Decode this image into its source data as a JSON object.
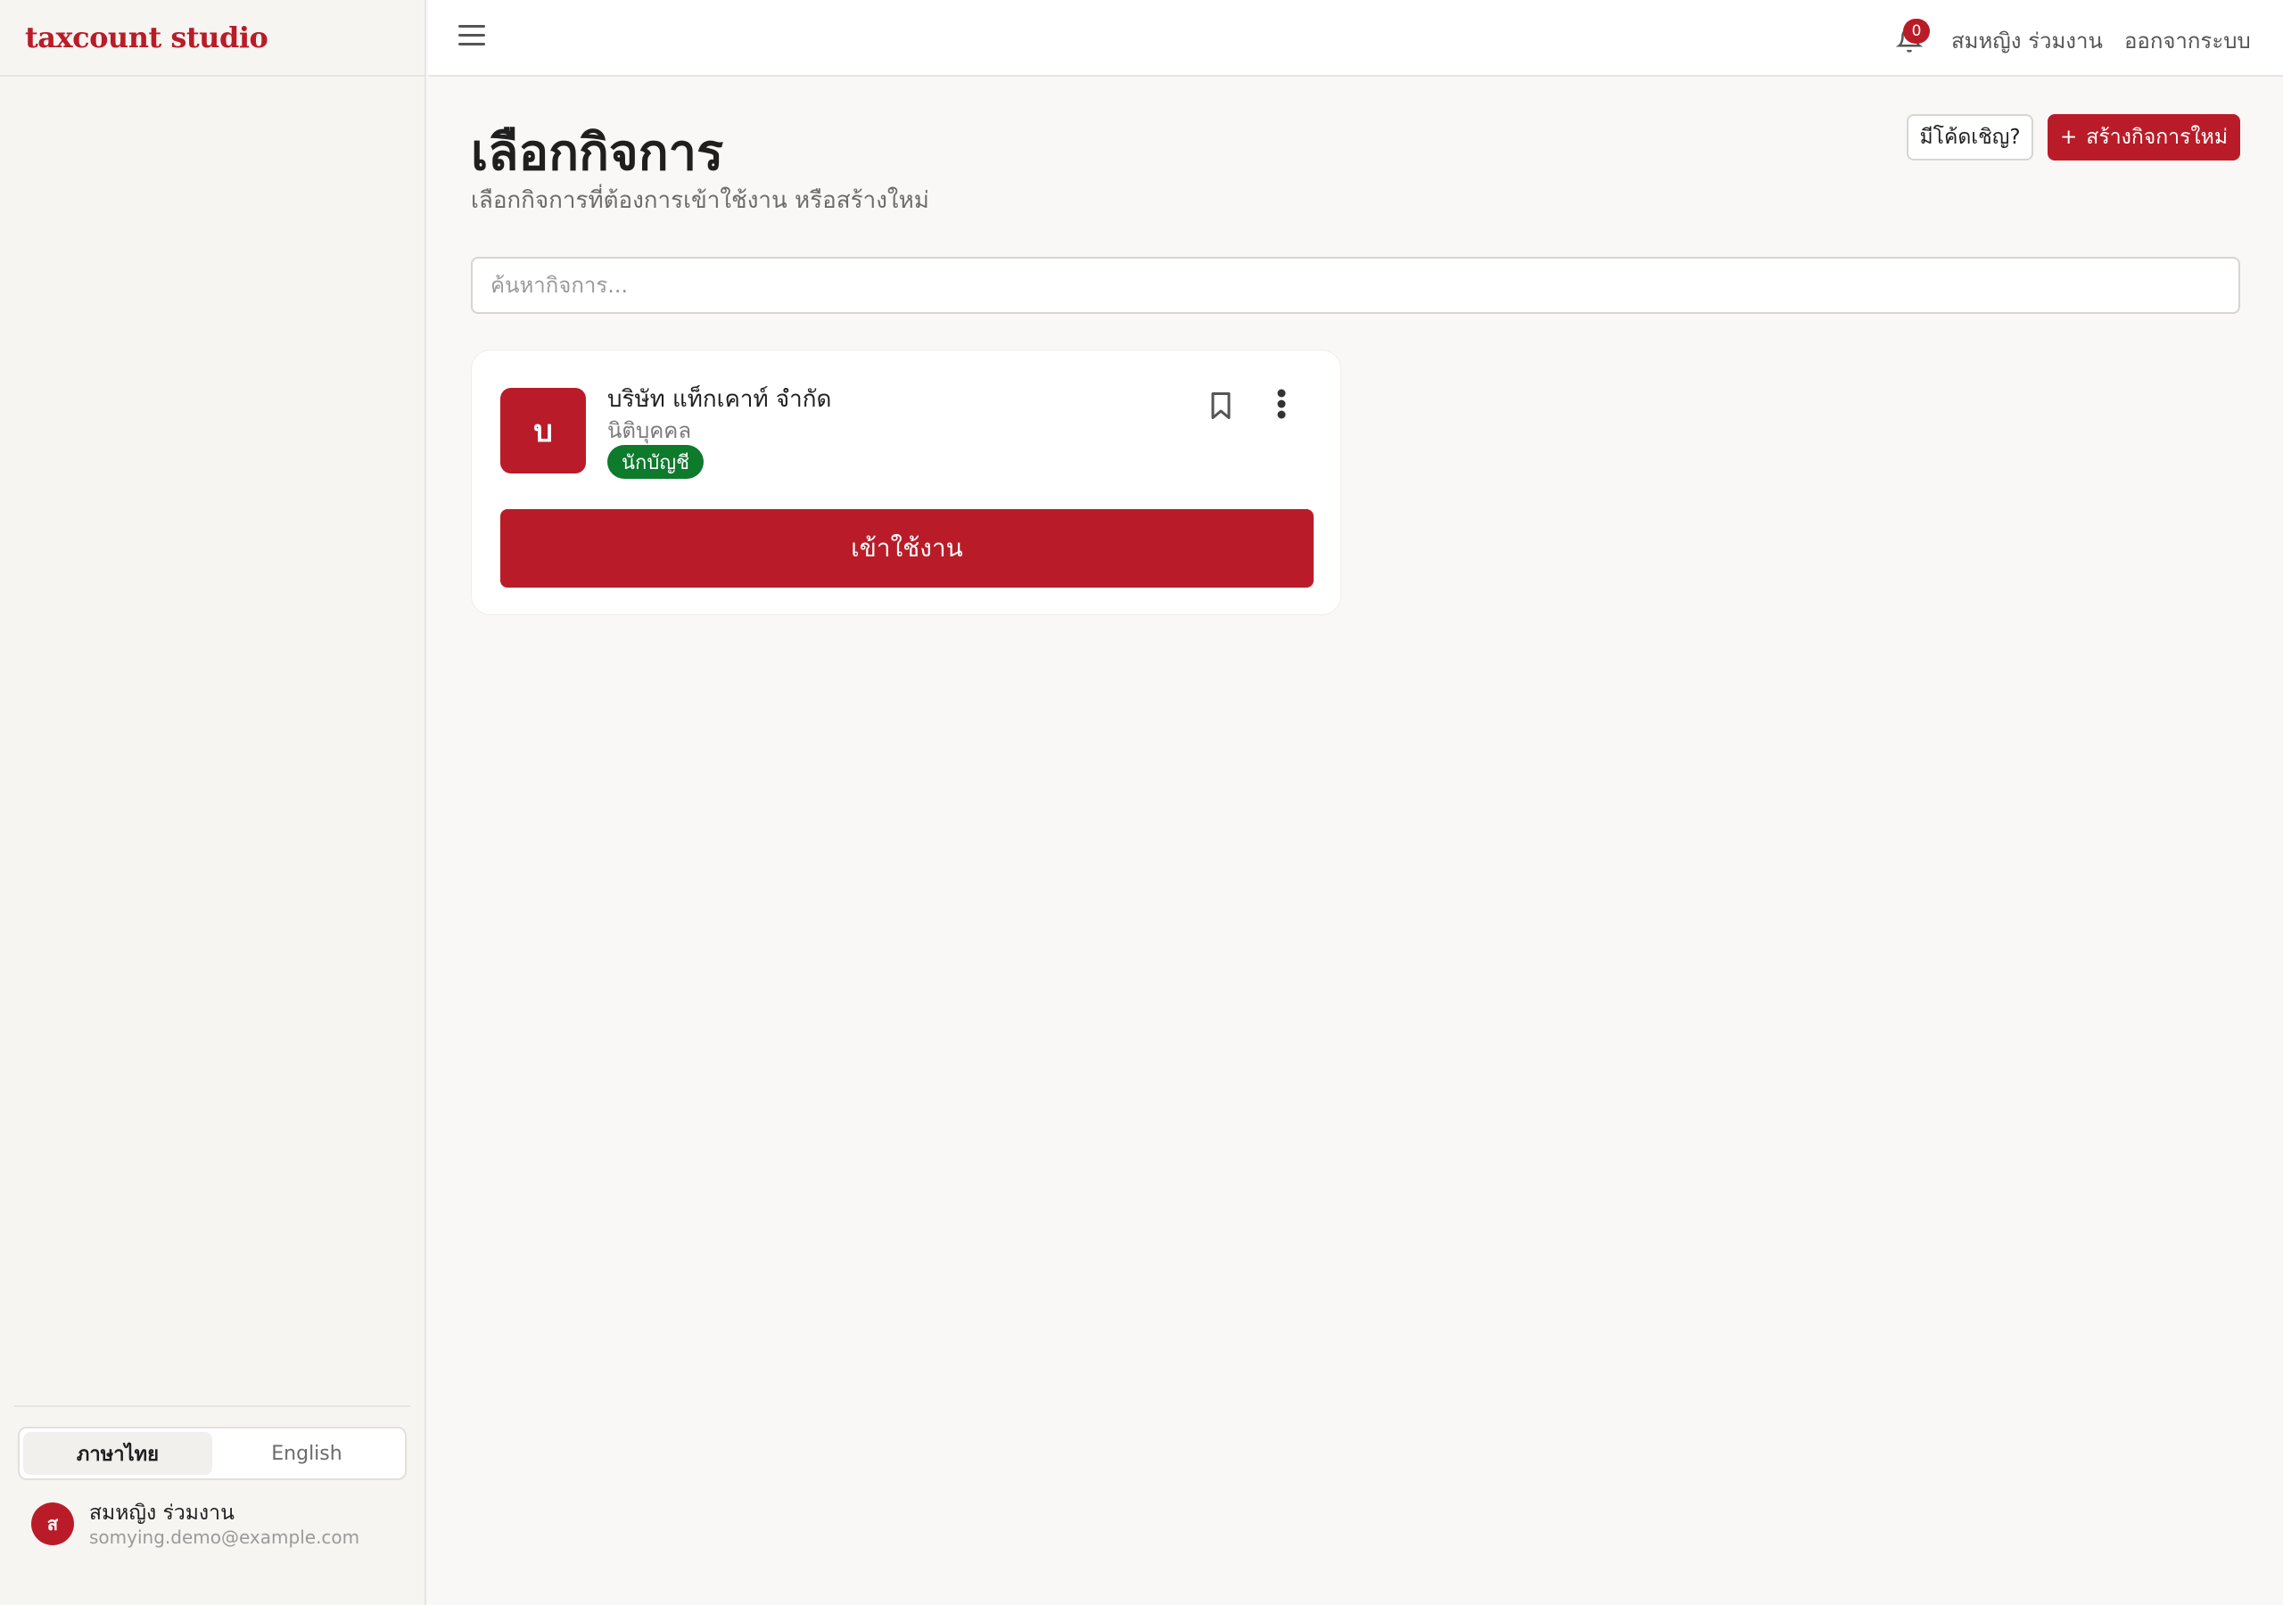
{
  "app": {
    "brand": "taxcount studio"
  },
  "topbar": {
    "notification_count": "0",
    "user_name": "สมหญิง ร่วมงาน",
    "logout_label": "ออกจากระบบ"
  },
  "page": {
    "title": "เลือกกิจการ",
    "subtitle": "เลือกกิจการที่ต้องการเข้าใช้งาน หรือสร้างใหม่",
    "invite_label": "มีโค้ดเชิญ?",
    "create_icon": "+",
    "create_label": "สร้างกิจการใหม่",
    "search_placeholder": "ค้นหากิจการ..."
  },
  "businesses": [
    {
      "initial": "บ",
      "name": "บริษัท แท็กเคาท์ จำกัด",
      "type": "นิติบุคคล",
      "role": "นักบัญชี",
      "enter_label": "เข้าใช้งาน"
    }
  ],
  "sidebar": {
    "languages": [
      "ภาษาไทย",
      "English"
    ],
    "active_language": "ภาษาไทย",
    "user": {
      "initial": "ส",
      "name": "สมหญิง ร่วมงาน",
      "email": "somying.demo@example.com"
    }
  },
  "colors": {
    "accent": "#b91c28",
    "role_badge": "#0d7a2c",
    "background": "#f9f8f6"
  }
}
